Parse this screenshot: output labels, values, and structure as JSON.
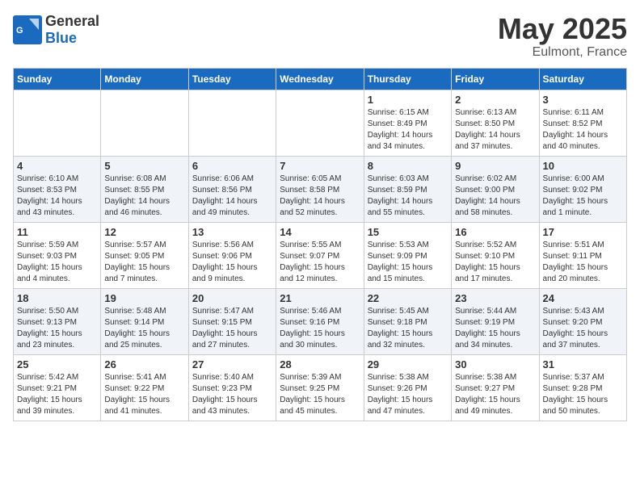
{
  "header": {
    "logo_general": "General",
    "logo_blue": "Blue",
    "month": "May 2025",
    "location": "Eulmont, France"
  },
  "days_of_week": [
    "Sunday",
    "Monday",
    "Tuesday",
    "Wednesday",
    "Thursday",
    "Friday",
    "Saturday"
  ],
  "weeks": [
    [
      {
        "day": "",
        "info": ""
      },
      {
        "day": "",
        "info": ""
      },
      {
        "day": "",
        "info": ""
      },
      {
        "day": "",
        "info": ""
      },
      {
        "day": "1",
        "info": "Sunrise: 6:15 AM\nSunset: 8:49 PM\nDaylight: 14 hours\nand 34 minutes."
      },
      {
        "day": "2",
        "info": "Sunrise: 6:13 AM\nSunset: 8:50 PM\nDaylight: 14 hours\nand 37 minutes."
      },
      {
        "day": "3",
        "info": "Sunrise: 6:11 AM\nSunset: 8:52 PM\nDaylight: 14 hours\nand 40 minutes."
      }
    ],
    [
      {
        "day": "4",
        "info": "Sunrise: 6:10 AM\nSunset: 8:53 PM\nDaylight: 14 hours\nand 43 minutes."
      },
      {
        "day": "5",
        "info": "Sunrise: 6:08 AM\nSunset: 8:55 PM\nDaylight: 14 hours\nand 46 minutes."
      },
      {
        "day": "6",
        "info": "Sunrise: 6:06 AM\nSunset: 8:56 PM\nDaylight: 14 hours\nand 49 minutes."
      },
      {
        "day": "7",
        "info": "Sunrise: 6:05 AM\nSunset: 8:58 PM\nDaylight: 14 hours\nand 52 minutes."
      },
      {
        "day": "8",
        "info": "Sunrise: 6:03 AM\nSunset: 8:59 PM\nDaylight: 14 hours\nand 55 minutes."
      },
      {
        "day": "9",
        "info": "Sunrise: 6:02 AM\nSunset: 9:00 PM\nDaylight: 14 hours\nand 58 minutes."
      },
      {
        "day": "10",
        "info": "Sunrise: 6:00 AM\nSunset: 9:02 PM\nDaylight: 15 hours\nand 1 minute."
      }
    ],
    [
      {
        "day": "11",
        "info": "Sunrise: 5:59 AM\nSunset: 9:03 PM\nDaylight: 15 hours\nand 4 minutes."
      },
      {
        "day": "12",
        "info": "Sunrise: 5:57 AM\nSunset: 9:05 PM\nDaylight: 15 hours\nand 7 minutes."
      },
      {
        "day": "13",
        "info": "Sunrise: 5:56 AM\nSunset: 9:06 PM\nDaylight: 15 hours\nand 9 minutes."
      },
      {
        "day": "14",
        "info": "Sunrise: 5:55 AM\nSunset: 9:07 PM\nDaylight: 15 hours\nand 12 minutes."
      },
      {
        "day": "15",
        "info": "Sunrise: 5:53 AM\nSunset: 9:09 PM\nDaylight: 15 hours\nand 15 minutes."
      },
      {
        "day": "16",
        "info": "Sunrise: 5:52 AM\nSunset: 9:10 PM\nDaylight: 15 hours\nand 17 minutes."
      },
      {
        "day": "17",
        "info": "Sunrise: 5:51 AM\nSunset: 9:11 PM\nDaylight: 15 hours\nand 20 minutes."
      }
    ],
    [
      {
        "day": "18",
        "info": "Sunrise: 5:50 AM\nSunset: 9:13 PM\nDaylight: 15 hours\nand 23 minutes."
      },
      {
        "day": "19",
        "info": "Sunrise: 5:48 AM\nSunset: 9:14 PM\nDaylight: 15 hours\nand 25 minutes."
      },
      {
        "day": "20",
        "info": "Sunrise: 5:47 AM\nSunset: 9:15 PM\nDaylight: 15 hours\nand 27 minutes."
      },
      {
        "day": "21",
        "info": "Sunrise: 5:46 AM\nSunset: 9:16 PM\nDaylight: 15 hours\nand 30 minutes."
      },
      {
        "day": "22",
        "info": "Sunrise: 5:45 AM\nSunset: 9:18 PM\nDaylight: 15 hours\nand 32 minutes."
      },
      {
        "day": "23",
        "info": "Sunrise: 5:44 AM\nSunset: 9:19 PM\nDaylight: 15 hours\nand 34 minutes."
      },
      {
        "day": "24",
        "info": "Sunrise: 5:43 AM\nSunset: 9:20 PM\nDaylight: 15 hours\nand 37 minutes."
      }
    ],
    [
      {
        "day": "25",
        "info": "Sunrise: 5:42 AM\nSunset: 9:21 PM\nDaylight: 15 hours\nand 39 minutes."
      },
      {
        "day": "26",
        "info": "Sunrise: 5:41 AM\nSunset: 9:22 PM\nDaylight: 15 hours\nand 41 minutes."
      },
      {
        "day": "27",
        "info": "Sunrise: 5:40 AM\nSunset: 9:23 PM\nDaylight: 15 hours\nand 43 minutes."
      },
      {
        "day": "28",
        "info": "Sunrise: 5:39 AM\nSunset: 9:25 PM\nDaylight: 15 hours\nand 45 minutes."
      },
      {
        "day": "29",
        "info": "Sunrise: 5:38 AM\nSunset: 9:26 PM\nDaylight: 15 hours\nand 47 minutes."
      },
      {
        "day": "30",
        "info": "Sunrise: 5:38 AM\nSunset: 9:27 PM\nDaylight: 15 hours\nand 49 minutes."
      },
      {
        "day": "31",
        "info": "Sunrise: 5:37 AM\nSunset: 9:28 PM\nDaylight: 15 hours\nand 50 minutes."
      }
    ]
  ]
}
